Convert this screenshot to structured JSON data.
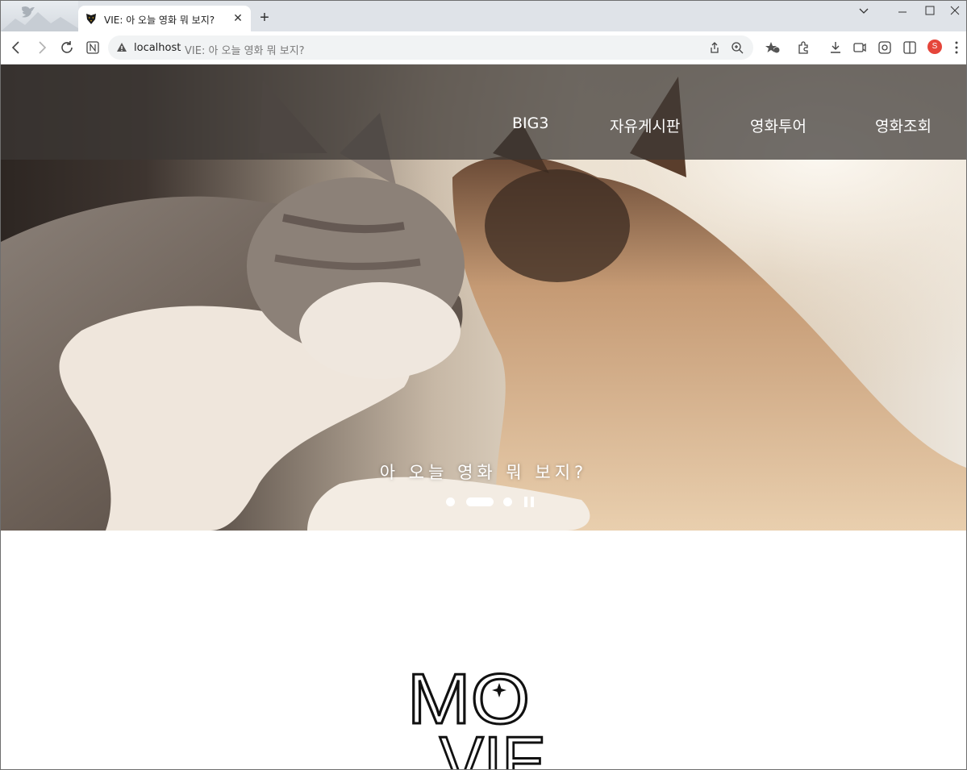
{
  "browser": {
    "tab_title": "VIE: 아 오늘 영화 뭐 보지?",
    "address_host": "localhost",
    "address_title": "VIE: 아 오늘 영화 뭐 보지?",
    "profile_initial": "S"
  },
  "nav": {
    "items": [
      "BIG3",
      "자유게시판",
      "영화투어",
      "영화조회"
    ]
  },
  "hero": {
    "caption": "아 오늘 영화 뭐 보지?",
    "slide_count": 3,
    "active_slide": 2
  },
  "logo": {
    "line1": "MO",
    "line2": "VIE"
  }
}
